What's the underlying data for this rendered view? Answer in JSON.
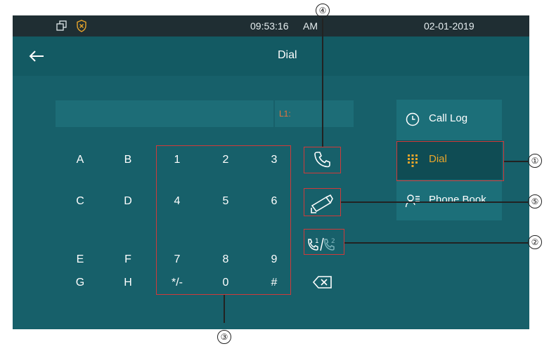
{
  "statusbar": {
    "time": "09:53:16",
    "ampm": "AM",
    "date": "02-01-2019"
  },
  "header": {
    "back_icon": "back-arrow-icon",
    "title": "Dial"
  },
  "dial_input": {
    "line_label": "L1:"
  },
  "letters": [
    "A",
    "B",
    "C",
    "D",
    "E",
    "F",
    "G",
    "H"
  ],
  "digits": [
    "1",
    "2",
    "3",
    "4",
    "5",
    "6",
    "7",
    "8",
    "9",
    "*/-",
    "0",
    "#"
  ],
  "menu": {
    "items": [
      {
        "label": "Call Log",
        "icon": "clock-icon"
      },
      {
        "label": "Dial",
        "icon": "keypad-icon",
        "active": true
      },
      {
        "label": "Phone Book",
        "icon": "contacts-icon"
      }
    ]
  },
  "callouts": [
    "①",
    "②",
    "③",
    "④",
    "⑤"
  ],
  "colors": {
    "screen_bg": "#17606a",
    "statusbar_bg": "#1f2e33",
    "accent_orange": "#e8a52b",
    "callout_red": "#d03a3a"
  }
}
